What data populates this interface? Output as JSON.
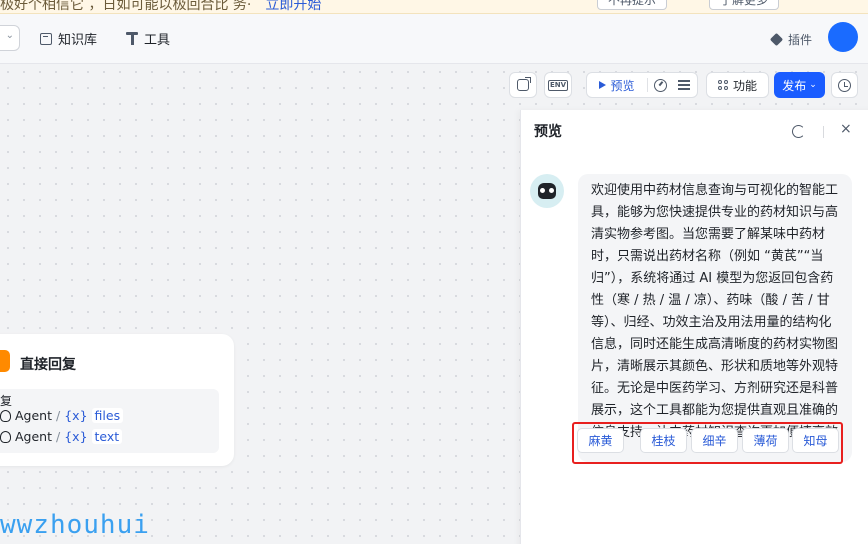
{
  "banner": {
    "text": "极好个相信它 ，日如可能以极回合比 务·",
    "link": "立即开始",
    "btn1": "不再提示",
    "btn2": "了解更多"
  },
  "header": {
    "knowledge": "知识库",
    "tools": "工具",
    "plugin": "插件"
  },
  "toolbar": {
    "env_label": "ENV",
    "preview": "预览",
    "features": "功能",
    "publish": "发布"
  },
  "node": {
    "title": "直接回复",
    "box_label": "复",
    "rows": [
      {
        "agent": "Agent",
        "slash": "/",
        "varx": "{x}",
        "var": "files"
      },
      {
        "agent": "Agent",
        "slash": "/",
        "varx": "{x}",
        "var": "text"
      }
    ]
  },
  "watermark": "wwzhouhui",
  "preview": {
    "title": "预览",
    "close": "×",
    "message": "欢迎使用中药材信息查询与可视化的智能工具，能够为您快速提供专业的药材知识与高清实物参考图。当您需要了解某味中药材时，只需说出药材名称（例如 “黄芪”“当归”），系统将通过 AI 模型为您返回包含药性（寒 / 热 / 温 / 凉）、药味（酸 / 苦 / 甘等）、归经、功效主治及用法用量的结构化信息，同时还能生成高清晰度的药材实物图片，清晰展示其颜色、形状和质地等外观特征。无论是中医药学习、方剂研究还是科普展示，这个工具都能为您提供直观且准确的信息支持，让中药材知识查询更加便捷高效",
    "suggestions": [
      "麻黄",
      "桂枝",
      "细辛",
      "薄荷",
      "知母"
    ]
  }
}
